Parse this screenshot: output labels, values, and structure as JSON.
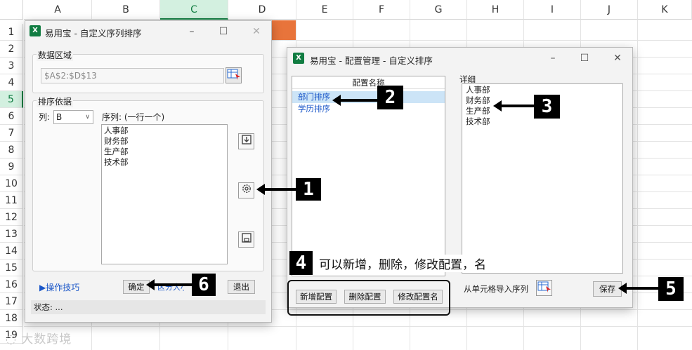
{
  "sheet": {
    "columns": [
      "A",
      "B",
      "C",
      "D",
      "E",
      "F",
      "G",
      "H",
      "I",
      "J",
      "K"
    ],
    "selected_column": "C",
    "rows": [
      "1",
      "2",
      "3",
      "4",
      "5",
      "6",
      "7",
      "8",
      "9",
      "10",
      "11",
      "12",
      "13",
      "14",
      "15",
      "16",
      "17",
      "18",
      "19"
    ],
    "selected_row": "5"
  },
  "dialog1": {
    "icon": "X",
    "title": "易用宝 - 自定义序列排序",
    "data_area_label": "数据区域",
    "data_area_value": "$A$2:$D$13",
    "sort_basis_label": "排序依据",
    "column_label": "列:",
    "column_value": "B",
    "sequence_label": "序列: (一行一个)",
    "sequence_items": [
      "人事部",
      "财务部",
      "生产部",
      "技术部"
    ],
    "tips_link": "▶操作技巧",
    "ok_button": "确定",
    "hidden_partial_text": "区分大小写",
    "exit_button": "退出",
    "status_label": "状态: ..."
  },
  "dialog2": {
    "icon": "X",
    "title": "易用宝 - 配置管理 - 自定义排序",
    "config_name_header": "配置名称",
    "config_items": [
      "部门排序",
      "学历排序"
    ],
    "selected_config": "部门排序",
    "detail_label": "详细",
    "detail_items": [
      "人事部",
      "财务部",
      "生产部",
      "技术部"
    ],
    "new_config_button": "新增配置",
    "delete_config_button": "删除配置",
    "rename_config_button": "修改配置名",
    "import_from_cells_label": "从单元格导入序列",
    "save_button": "保存"
  },
  "annotations": {
    "badge1": "1",
    "badge2": "2",
    "badge3": "3",
    "badge4": "4",
    "badge5": "5",
    "badge6": "6",
    "note4": "可以新增，删除，修改配置，名"
  },
  "watermark": "大数跨境",
  "colors": {
    "excel_green": "#107c41",
    "selection_blue": "#cce4f7",
    "link_blue": "#1a56c8",
    "orange_cell": "#e8743b"
  }
}
